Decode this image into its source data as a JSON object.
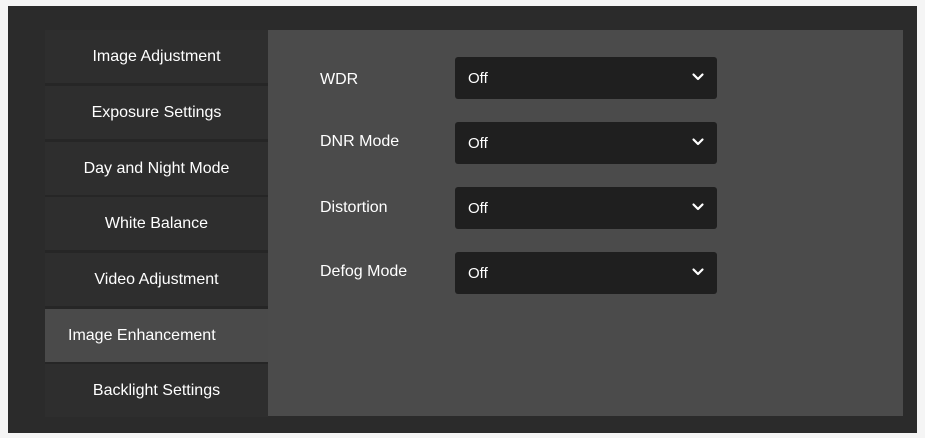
{
  "sidebar": {
    "items": [
      {
        "label": "Image Adjustment",
        "active": false
      },
      {
        "label": "Exposure Settings",
        "active": false
      },
      {
        "label": "Day and Night Mode",
        "active": false
      },
      {
        "label": "White Balance",
        "active": false
      },
      {
        "label": "Video Adjustment",
        "active": false
      },
      {
        "label": "Image Enhancement",
        "active": true
      },
      {
        "label": "Backlight Settings",
        "active": false
      }
    ]
  },
  "form": {
    "rows": [
      {
        "label": "WDR",
        "value": "Off"
      },
      {
        "label": "DNR Mode",
        "value": "Off"
      },
      {
        "label": "Distortion",
        "value": "Off"
      },
      {
        "label": "Defog Mode",
        "value": "Off"
      }
    ]
  },
  "colors": {
    "background": "#2b2b2b",
    "sidebar_item": "#2e2e2e",
    "sidebar_active": "#4a4a4a",
    "panel": "#4b4b4b",
    "select_bg": "#1f1f1f",
    "text": "#ffffff"
  },
  "icons": {
    "dropdown": "chevron-down-icon"
  }
}
